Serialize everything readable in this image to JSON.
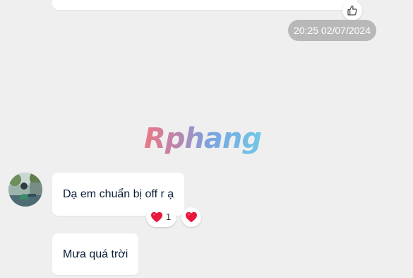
{
  "chat": {
    "timestamp": "20:25 02/07/2024",
    "watermark": "Rphang",
    "messages": [
      {
        "text": "Dạ em chuẩn bị off r ạ",
        "reactions": [
          {
            "icon": "heart-icon",
            "count": "1"
          }
        ],
        "reaction_button_icon": "heart-icon"
      },
      {
        "text": "Mưa quá trời"
      }
    ]
  },
  "icons": {
    "like": "thumbs-up-icon",
    "heart": "heart-icon"
  },
  "colors": {
    "chat_background": "#efefef",
    "bubble_background": "#ffffff",
    "timestamp_background": "#b8b8b8",
    "text": "#081c36",
    "heart": "#e8173c"
  }
}
